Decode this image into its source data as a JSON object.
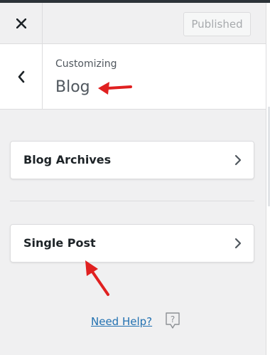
{
  "header": {
    "close_icon": "close-icon",
    "publish_label": "Published"
  },
  "title_panel": {
    "back_icon": "chevron-left-icon",
    "customizing_label": "Customizing",
    "section_title": "Blog"
  },
  "panels": [
    {
      "label": "Blog Archives",
      "icon": "chevron-right-icon"
    },
    {
      "label": "Single Post",
      "icon": "chevron-right-icon"
    }
  ],
  "footer": {
    "help_label": "Need Help?",
    "help_icon": "question-bubble-icon"
  },
  "colors": {
    "annotation_arrow": "#e02020",
    "link": "#2271b1",
    "background": "#f0f0f1"
  }
}
